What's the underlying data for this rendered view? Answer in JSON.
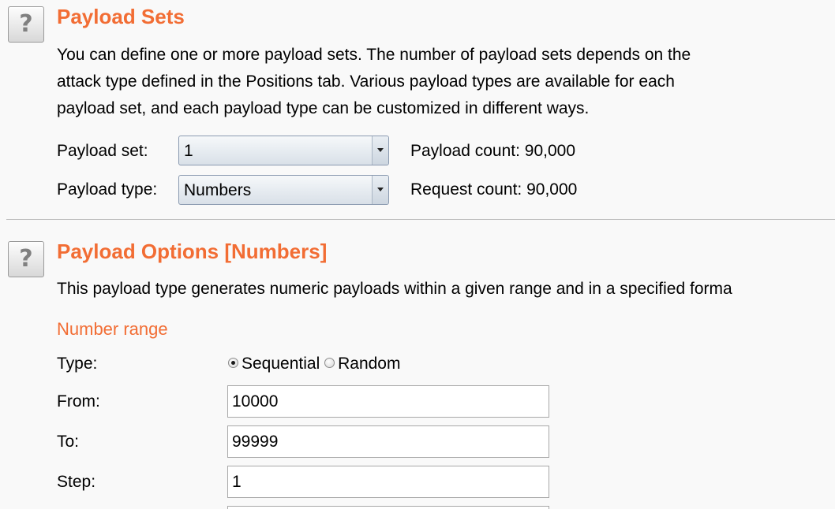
{
  "payload_sets": {
    "help_icon": "question-mark-icon",
    "help_symbol": "?",
    "title": "Payload Sets",
    "description_lines": [
      "You can define one or more payload sets. The number of payload sets depends on the",
      "attack type defined in the Positions tab. Various payload types are available for each",
      "payload set, and each payload type can be customized in different ways."
    ],
    "payload_set_label": "Payload set:",
    "payload_set_value": "1",
    "payload_type_label": "Payload type:",
    "payload_type_value": "Numbers",
    "payload_count": "Payload count: 90,000",
    "request_count": "Request count: 90,000"
  },
  "payload_options": {
    "help_icon": "question-mark-icon",
    "help_symbol": "?",
    "title": "Payload Options [Numbers]",
    "description": "This payload type generates numeric payloads within a given range and in a specified forma",
    "number_range_heading": "Number range",
    "type_label": "Type:",
    "type_options": [
      "Sequential",
      "Random"
    ],
    "type_selected": "Sequential",
    "from_label": "From:",
    "from_value": "10000",
    "to_label": "To:",
    "to_value": "99999",
    "step_label": "Step:",
    "step_value": "1"
  },
  "colors": {
    "heading": "#f26d34",
    "background": "#f9f9f9"
  }
}
